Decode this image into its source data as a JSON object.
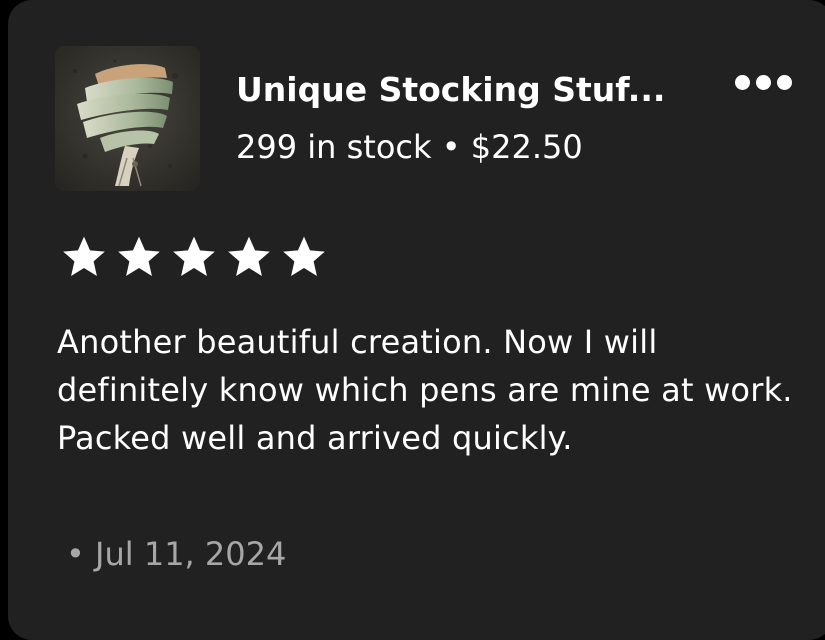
{
  "listing": {
    "title": "Unique Stocking Stuf...",
    "stock_price": "299 in stock • $22.50",
    "thumbnail_icon": "product-photo"
  },
  "menu": {
    "icon": "more-options-icon"
  },
  "review": {
    "rating": 5,
    "rating_max": 5,
    "text": "Another beautiful creation. Now I will definitely know which pens are mine at work. Packed well and arrived quickly.",
    "date": "• Jul 11, 2024"
  },
  "colors": {
    "background": "#212121",
    "text": "#ffffff",
    "muted_text": "#a7a7a7"
  }
}
